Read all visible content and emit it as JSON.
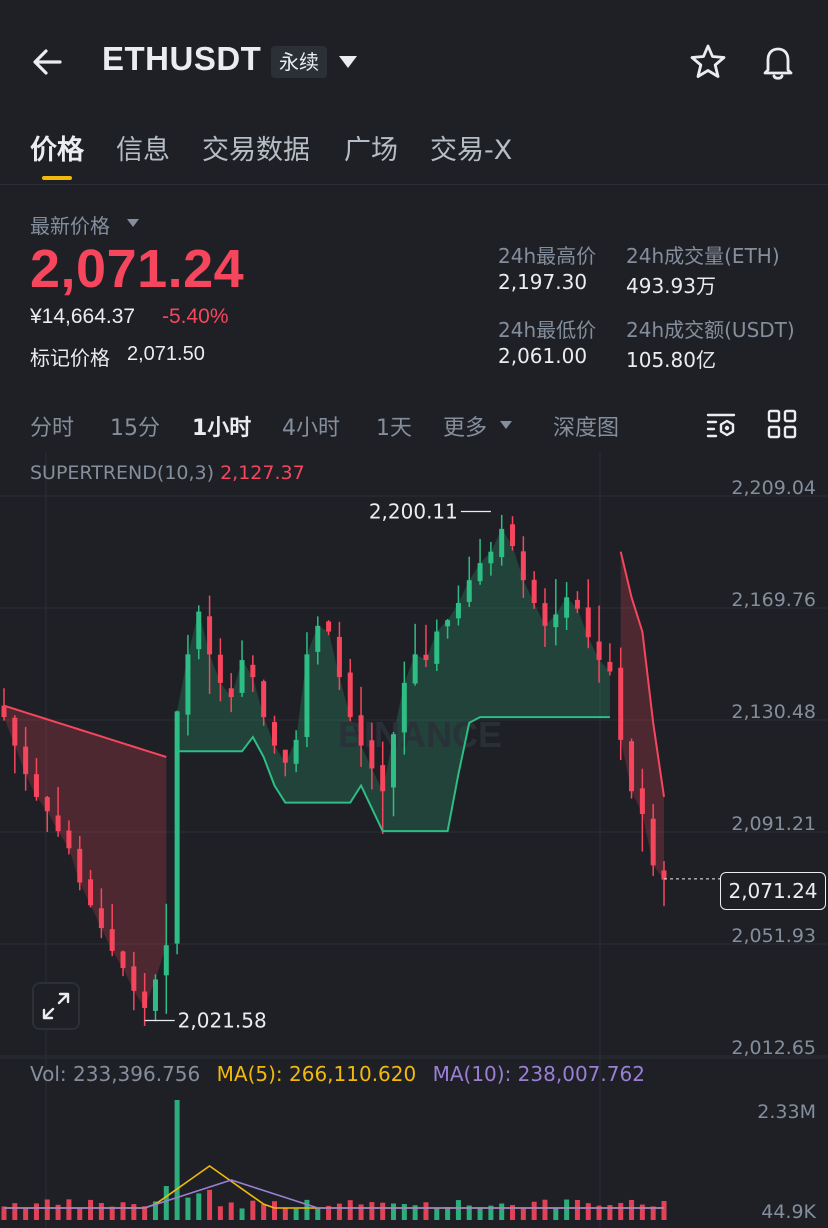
{
  "header": {
    "symbol": "ETHUSDT",
    "contract_type": "永续"
  },
  "tabs": [
    {
      "label": "价格",
      "active": true
    },
    {
      "label": "信息",
      "active": false
    },
    {
      "label": "交易数据",
      "active": false
    },
    {
      "label": "广场",
      "active": false
    },
    {
      "label": "交易-X",
      "active": false
    }
  ],
  "price": {
    "latest_label": "最新价格",
    "last": "2,071.24",
    "cny": "¥14,664.37",
    "change": "-5.40%",
    "mark_label": "标记价格",
    "mark": "2,071.50"
  },
  "stats": {
    "high_label": "24h最高价",
    "high": "2,197.30",
    "vol_eth_label": "24h成交量(ETH)",
    "vol_eth": "493.93万",
    "low_label": "24h最低价",
    "low": "2,061.00",
    "vol_usdt_label": "24h成交额(USDT)",
    "vol_usdt": "105.80亿"
  },
  "intervals": [
    {
      "label": "分时",
      "active": false
    },
    {
      "label": "15分",
      "active": false
    },
    {
      "label": "1小时",
      "active": true
    },
    {
      "label": "4小时",
      "active": false
    },
    {
      "label": "1天",
      "active": false
    },
    {
      "label": "更多",
      "active": false
    },
    {
      "label": "深度图",
      "active": false
    }
  ],
  "indicator": {
    "name": "SUPERTREND(10,3)",
    "value": "2,127.37"
  },
  "volume": {
    "vol_label": "Vol: 233,396.756",
    "ma5_label": "MA(5): 266,110.620",
    "ma10_label": "MA(10): 238,007.762",
    "axis_top": "2.33M",
    "axis_bottom": "44.9K"
  },
  "colors": {
    "up": "#2ebd85",
    "down": "#f6465d",
    "accent": "#f0b90b",
    "ma5": "#f0b90b",
    "ma10": "#9b7fd4"
  },
  "watermark": "BINANCE",
  "chart_data": {
    "type": "candlestick",
    "interval": "1小时",
    "y_axis_labels": [
      "2,209.04",
      "2,169.76",
      "2,130.48",
      "2,091.21",
      "2,051.93",
      "2,012.65"
    ],
    "ylim": [
      2012.65,
      2209.04
    ],
    "annotations": {
      "high": "2,200.11",
      "low": "2,021.58",
      "last": "2,071.24"
    },
    "close_path": [
      2128,
      2118,
      2108,
      2100,
      2095,
      2088,
      2082,
      2070,
      2062,
      2054,
      2046,
      2040,
      2032,
      2026,
      2036,
      2048,
      2130,
      2150,
      2165,
      2150,
      2140,
      2135,
      2148,
      2142,
      2128,
      2118,
      2112,
      2120,
      2150,
      2160,
      2158,
      2142,
      2128,
      2118,
      2110,
      2102,
      2122,
      2140,
      2150,
      2148,
      2158,
      2162,
      2168,
      2176,
      2182,
      2186,
      2194,
      2188,
      2176,
      2168,
      2160,
      2164,
      2170,
      2166,
      2156,
      2148,
      2144,
      2120,
      2102,
      2094,
      2076,
      2071
    ]
  }
}
